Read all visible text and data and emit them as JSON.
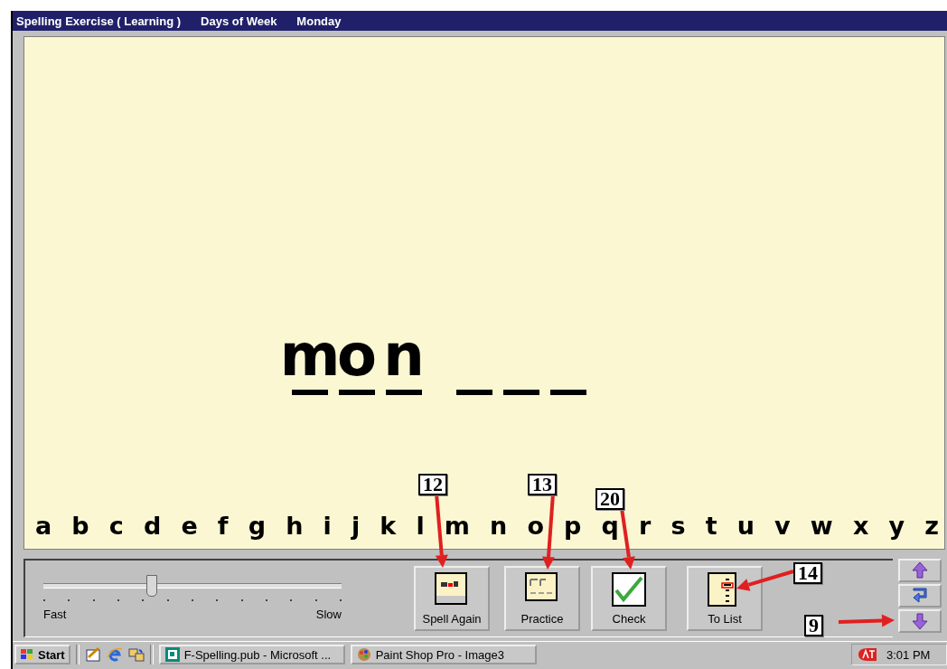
{
  "window": {
    "title_parts": [
      "Spelling Exercise ( Learning )",
      "Days of Week",
      "Monday"
    ]
  },
  "word_groups": [
    {
      "slots": [
        {
          "kind": "letter",
          "letter": "m"
        },
        {
          "kind": "letter",
          "letter": "o"
        },
        {
          "kind": "letter",
          "letter": "n"
        }
      ]
    },
    {
      "slots": [
        {
          "kind": "blank"
        },
        {
          "kind": "blank"
        },
        {
          "kind": "blank"
        }
      ]
    }
  ],
  "alphabet": [
    "a",
    "b",
    "c",
    "d",
    "e",
    "f",
    "g",
    "h",
    "i",
    "j",
    "k",
    "l",
    "m",
    "n",
    "o",
    "p",
    "q",
    "r",
    "s",
    "t",
    "u",
    "v",
    "w",
    "x",
    "y",
    "z"
  ],
  "speed_slider": {
    "level": 0.36,
    "min_label": "Fast",
    "max_label": "Slow"
  },
  "buttons": [
    {
      "kind": "spell",
      "label": "Spell Again"
    },
    {
      "kind": "practice",
      "label": "Practice"
    },
    {
      "kind": "check",
      "label": "Check"
    },
    {
      "kind": "list",
      "label": "To List"
    }
  ],
  "nav_buttons": [
    {
      "kind": "up"
    },
    {
      "kind": "return"
    },
    {
      "kind": "down"
    }
  ],
  "callouts": [
    {
      "number": "12"
    },
    {
      "number": "13"
    },
    {
      "number": "20"
    },
    {
      "number": "14"
    },
    {
      "number": "9"
    }
  ],
  "taskbar": {
    "start": "Start",
    "tasks": [
      "F-Spelling.pub - Microsoft ...",
      "Paint Shop Pro - Image3"
    ],
    "clock": "3:01 PM"
  }
}
